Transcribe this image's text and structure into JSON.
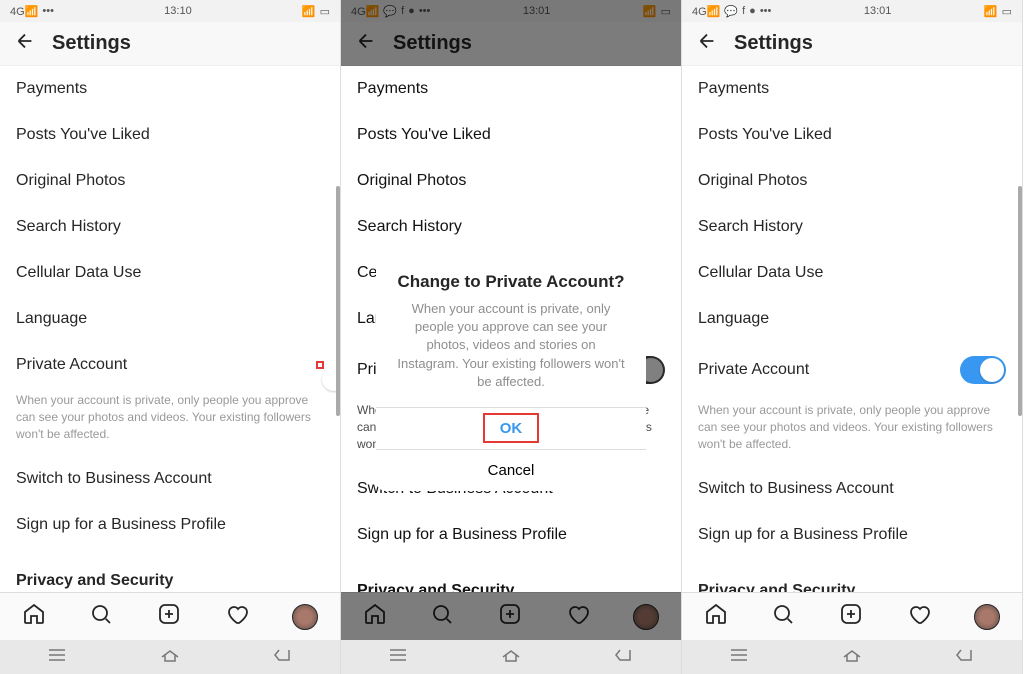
{
  "screens": [
    {
      "statusbar": {
        "network": "4G",
        "time": "13:10",
        "signal": "•••",
        "has_chat_icons": false
      },
      "header": {
        "title": "Settings"
      },
      "items": {
        "payments": "Payments",
        "posts_liked": "Posts You've Liked",
        "original_photos": "Original Photos",
        "search_history": "Search History",
        "cellular": "Cellular Data Use",
        "language": "Language",
        "private_account": "Private Account",
        "private_desc": "When your account is private, only people you approve can see your photos and videos. Your existing followers won't be affected.",
        "switch_business": "Switch to Business Account",
        "signup_business": "Sign up for a Business Profile",
        "privacy_section": "Privacy and Security"
      },
      "private_toggle_on": false,
      "highlight_toggle": true,
      "scrollbar_visible": true
    },
    {
      "statusbar": {
        "network": "4G",
        "time": "13:01",
        "signal": "•••",
        "has_chat_icons": true
      },
      "header": {
        "title": "Settings"
      },
      "items": {
        "payments": "Payments",
        "posts_liked": "Posts You've Liked",
        "original_photos": "Original Photos",
        "search_history": "Search History",
        "cellular": "Cellular Data Use",
        "language": "Language",
        "private_account": "Private Account",
        "private_desc": "When your account is private, only people you approve can see your photos and videos. Your existing followers won't be affected.",
        "switch_business": "Switch to Business Account",
        "signup_business": "Sign up for a Business Profile",
        "privacy_section": "Privacy and Security"
      },
      "dialog": {
        "title": "Change to Private Account?",
        "body": "When your account is private, only people you approve can see your photos, videos and stories on Instagram. Your existing followers won't be affected.",
        "ok": "OK",
        "cancel": "Cancel"
      }
    },
    {
      "statusbar": {
        "network": "4G",
        "time": "13:01",
        "signal": "•••",
        "has_chat_icons": true
      },
      "header": {
        "title": "Settings"
      },
      "items": {
        "payments": "Payments",
        "posts_liked": "Posts You've Liked",
        "original_photos": "Original Photos",
        "search_history": "Search History",
        "cellular": "Cellular Data Use",
        "language": "Language",
        "private_account": "Private Account",
        "private_desc": "When your account is private, only people you approve can see your photos and videos. Your existing followers won't be affected.",
        "switch_business": "Switch to Business Account",
        "signup_business": "Sign up for a Business Profile",
        "privacy_section": "Privacy and Security"
      },
      "private_toggle_on": true,
      "scrollbar_visible": true
    }
  ]
}
